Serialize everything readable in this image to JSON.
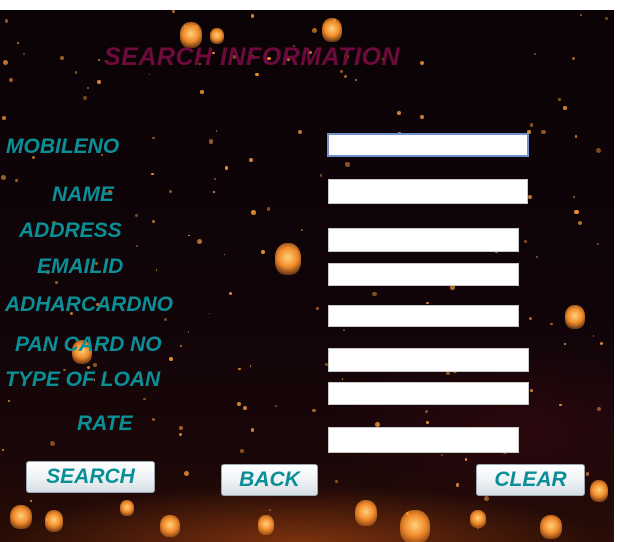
{
  "form": {
    "title": "SEARCH INFORMATION",
    "fields": [
      {
        "label": "MOBILENO",
        "value": ""
      },
      {
        "label": "NAME",
        "value": ""
      },
      {
        "label": "ADDRESS",
        "value": ""
      },
      {
        "label": "EMAILID",
        "value": ""
      },
      {
        "label": "ADHARCARDNO",
        "value": ""
      },
      {
        "label": "PAN CARD NO",
        "value": ""
      },
      {
        "label": "TYPE OF LOAN",
        "value": ""
      },
      {
        "label": "RATE",
        "value": ""
      }
    ],
    "buttons": {
      "search": "SEARCH",
      "back": "BACK",
      "clear": "CLEAR"
    }
  },
  "colors": {
    "title": "#6e0a3c",
    "label": "#0b8f96",
    "background": "#100409"
  }
}
